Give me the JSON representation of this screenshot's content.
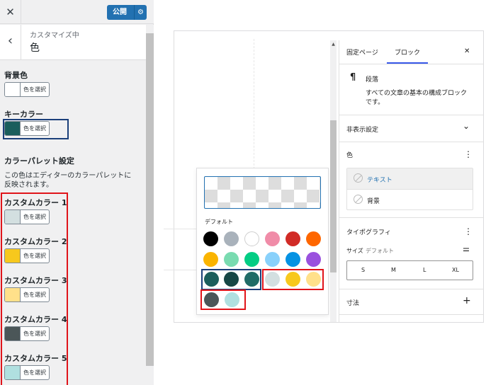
{
  "customizer": {
    "close_icon": "✕",
    "publish_label": "公開",
    "gear_icon": "⚙",
    "back_icon": "‹",
    "breadcrumb": "カスタマイズ中",
    "section_title": "色",
    "bg_label": "背景色",
    "key_label": "キーカラー",
    "palette_heading": "カラーパレット設定",
    "palette_desc_1": "この色はエディターのカラーパレットに",
    "palette_desc_2": "反映されます。",
    "select_label": "色を選択",
    "bg_color": "#ffffff",
    "key_color": "#1a5e5c",
    "custom_colors": [
      {
        "label": "カスタムカラー 1",
        "color": "#d3dfe0"
      },
      {
        "label": "カスタムカラー 2",
        "color": "#f7c81d"
      },
      {
        "label": "カスタムカラー 3",
        "color": "#ffe08a"
      },
      {
        "label": "カスタムカラー 4",
        "color": "#4b5658"
      },
      {
        "label": "カスタムカラー 5",
        "color": "#b0e0e0"
      }
    ]
  },
  "editor": {
    "palette_title": "デフォルト",
    "default_colors": [
      "#000000",
      "#a9b2bb",
      "#ffffff",
      "#f08ca8",
      "#d12b26",
      "#fe6600",
      "#fab400",
      "#79dbb0",
      "#03cd84",
      "#89d1fb",
      "#0592e3",
      "#9a51de"
    ],
    "theme_colors": [
      "#1b5e5c",
      "#164745",
      "#206c67"
    ],
    "custom_colors_row": [
      "#d3dfe0",
      "#f7c81d",
      "#ffe08a"
    ],
    "custom_colors_row2": [
      "#4b5658",
      "#b0e0e0"
    ]
  },
  "sidebar": {
    "tab_page": "固定ページ",
    "tab_block": "ブロック",
    "close_icon": "✕",
    "block_icon": "¶",
    "block_name": "段落",
    "block_desc_1": "すべての文章の基本の構成ブロック",
    "block_desc_2": "です。",
    "hide_settings": "非表示設定",
    "chevron_icon": "⌄",
    "color_title": "色",
    "more_icon": "⋮",
    "text_label": "テキスト",
    "bg_label": "背景",
    "typography_title": "タイポグラフィ",
    "size_label": "サイズ",
    "size_value": "デフォルト",
    "sliders_icon": "⚌",
    "sizes": [
      "S",
      "M",
      "L",
      "XL"
    ],
    "dimensions_title": "寸法",
    "plus_icon": "+",
    "accent": "#3858e9"
  }
}
